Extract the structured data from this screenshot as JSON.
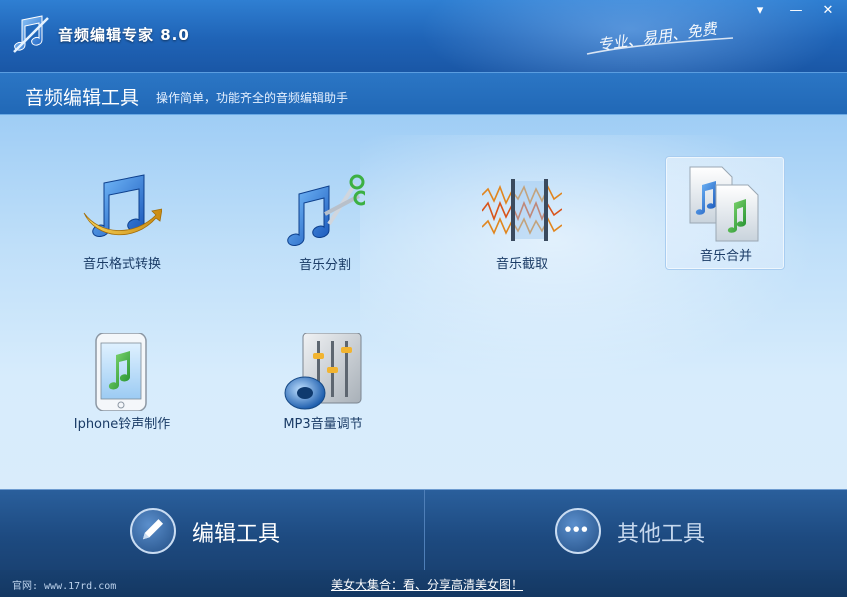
{
  "titlebar": {
    "app_title": "音频编辑专家 8.0",
    "slogan": "专业、易用、免费",
    "buttons": {
      "menu": "▾",
      "minimize": "—",
      "close": "✕"
    }
  },
  "subheader": {
    "title": "音频编辑工具",
    "description": "操作简单，功能齐全的音频编辑助手"
  },
  "tools": [
    {
      "label": "音乐格式转换",
      "icon": "music-convert-icon",
      "selected": false
    },
    {
      "label": "音乐分割",
      "icon": "music-split-scissors-icon",
      "selected": false
    },
    {
      "label": "音乐截取",
      "icon": "waveform-cut-icon",
      "selected": false
    },
    {
      "label": "音乐合并",
      "icon": "music-merge-documents-icon",
      "selected": true
    },
    {
      "label": "Iphone铃声制作",
      "icon": "iphone-ringtone-icon",
      "selected": false
    },
    {
      "label": "MP3音量调节",
      "icon": "volume-mixer-icon",
      "selected": false
    }
  ],
  "tabs": {
    "edit_tools": "编辑工具",
    "other_tools": "其他工具",
    "active": "edit_tools"
  },
  "statusbar": {
    "site": "官网: www.17rd.com",
    "promo": "美女大集合：看、分享高清美女图！"
  },
  "colors": {
    "titlebar": "#1f63b6",
    "content_bg": "#bfdff9",
    "tabbar": "#1d4a80",
    "label_text": "#1a3b66"
  }
}
